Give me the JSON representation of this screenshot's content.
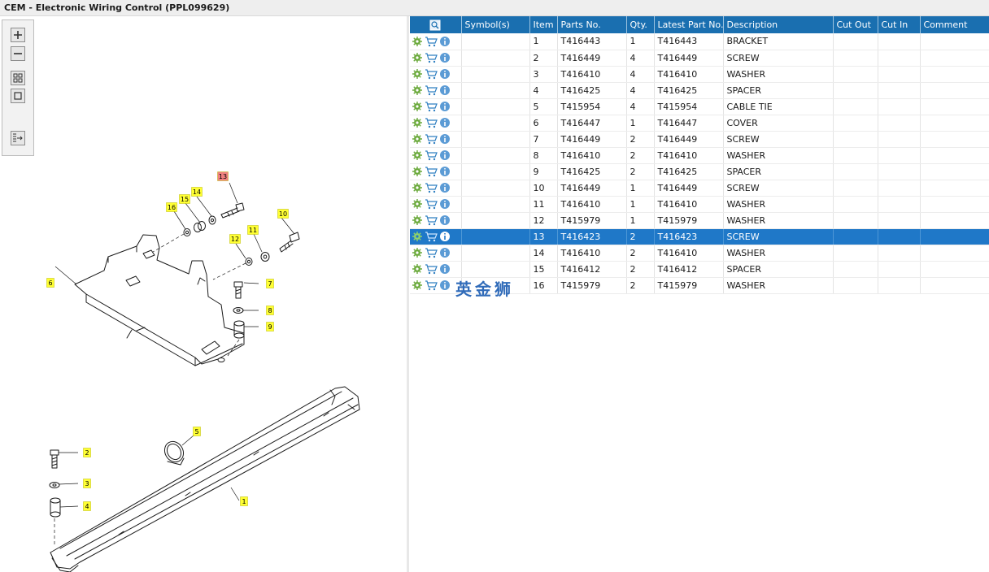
{
  "window": {
    "title": "CEM - Electronic Wiring Control (PPL099629)"
  },
  "toolbar": {
    "buttons": [
      {
        "name": "zoom-in",
        "icon": "plus-icon"
      },
      {
        "name": "zoom-out",
        "icon": "minus-icon"
      },
      {
        "name": "fit-page",
        "icon": "grid-icon"
      },
      {
        "name": "actual-size",
        "icon": "square-icon"
      },
      {
        "name": "export",
        "icon": "list-arrow-icon"
      }
    ]
  },
  "diagram": {
    "callouts": [
      "1",
      "2",
      "3",
      "4",
      "5",
      "6",
      "7",
      "8",
      "9",
      "10",
      "11",
      "12",
      "13",
      "14",
      "15",
      "16"
    ],
    "highlighted_callout": "13",
    "callout_color": "#ffff33",
    "highlight_color": "#f08080"
  },
  "table": {
    "columns": [
      "Symbol(s)",
      "Item",
      "Parts No.",
      "Qty.",
      "Latest Part No.",
      "Description",
      "Cut Out",
      "Cut In",
      "Comment"
    ],
    "header_icon": "search-icon",
    "header_color": "#1a6fb0",
    "selected_color": "#1f78c8",
    "rows": [
      {
        "symbols": "",
        "item": "1",
        "part_no": "T416443",
        "qty": "1",
        "latest_part_no": "T416443",
        "description": "BRACKET",
        "cut_out": "",
        "cut_in": "",
        "comment": ""
      },
      {
        "symbols": "",
        "item": "2",
        "part_no": "T416449",
        "qty": "4",
        "latest_part_no": "T416449",
        "description": "SCREW",
        "cut_out": "",
        "cut_in": "",
        "comment": ""
      },
      {
        "symbols": "",
        "item": "3",
        "part_no": "T416410",
        "qty": "4",
        "latest_part_no": "T416410",
        "description": "WASHER",
        "cut_out": "",
        "cut_in": "",
        "comment": ""
      },
      {
        "symbols": "",
        "item": "4",
        "part_no": "T416425",
        "qty": "4",
        "latest_part_no": "T416425",
        "description": "SPACER",
        "cut_out": "",
        "cut_in": "",
        "comment": ""
      },
      {
        "symbols": "",
        "item": "5",
        "part_no": "T415954",
        "qty": "4",
        "latest_part_no": "T415954",
        "description": "CABLE TIE",
        "cut_out": "",
        "cut_in": "",
        "comment": ""
      },
      {
        "symbols": "",
        "item": "6",
        "part_no": "T416447",
        "qty": "1",
        "latest_part_no": "T416447",
        "description": "COVER",
        "cut_out": "",
        "cut_in": "",
        "comment": ""
      },
      {
        "symbols": "",
        "item": "7",
        "part_no": "T416449",
        "qty": "2",
        "latest_part_no": "T416449",
        "description": "SCREW",
        "cut_out": "",
        "cut_in": "",
        "comment": ""
      },
      {
        "symbols": "",
        "item": "8",
        "part_no": "T416410",
        "qty": "2",
        "latest_part_no": "T416410",
        "description": "WASHER",
        "cut_out": "",
        "cut_in": "",
        "comment": ""
      },
      {
        "symbols": "",
        "item": "9",
        "part_no": "T416425",
        "qty": "2",
        "latest_part_no": "T416425",
        "description": "SPACER",
        "cut_out": "",
        "cut_in": "",
        "comment": ""
      },
      {
        "symbols": "",
        "item": "10",
        "part_no": "T416449",
        "qty": "1",
        "latest_part_no": "T416449",
        "description": "SCREW",
        "cut_out": "",
        "cut_in": "",
        "comment": ""
      },
      {
        "symbols": "",
        "item": "11",
        "part_no": "T416410",
        "qty": "1",
        "latest_part_no": "T416410",
        "description": "WASHER",
        "cut_out": "",
        "cut_in": "",
        "comment": ""
      },
      {
        "symbols": "",
        "item": "12",
        "part_no": "T415979",
        "qty": "1",
        "latest_part_no": "T415979",
        "description": "WASHER",
        "cut_out": "",
        "cut_in": "",
        "comment": ""
      },
      {
        "symbols": "",
        "item": "13",
        "part_no": "T416423",
        "qty": "2",
        "latest_part_no": "T416423",
        "description": "SCREW",
        "cut_out": "",
        "cut_in": "",
        "comment": "",
        "selected": true
      },
      {
        "symbols": "",
        "item": "14",
        "part_no": "T416410",
        "qty": "2",
        "latest_part_no": "T416410",
        "description": "WASHER",
        "cut_out": "",
        "cut_in": "",
        "comment": ""
      },
      {
        "symbols": "",
        "item": "15",
        "part_no": "T416412",
        "qty": "2",
        "latest_part_no": "T416412",
        "description": "SPACER",
        "cut_out": "",
        "cut_in": "",
        "comment": ""
      },
      {
        "symbols": "",
        "item": "16",
        "part_no": "T415979",
        "qty": "2",
        "latest_part_no": "T415979",
        "description": "WASHER",
        "cut_out": "",
        "cut_in": "",
        "comment": ""
      }
    ],
    "row_icons": [
      "gear-icon",
      "cart-icon",
      "info-icon"
    ]
  },
  "watermark": {
    "text": "英金狮"
  }
}
